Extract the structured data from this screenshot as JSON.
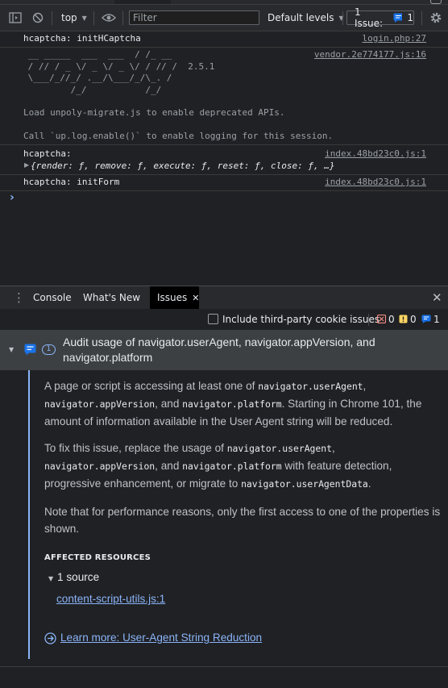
{
  "toolbar": {
    "context": "top",
    "filter_placeholder": "Filter",
    "levels": "Default levels",
    "issues_label": "1 Issue:",
    "issues_count": "1"
  },
  "console": {
    "messages": [
      {
        "text": "hcaptcha: initHCaptcha",
        "source": "login.php:27"
      },
      {
        "text": " __ _____  ___  ___  / /_ __\n / // / _ \\/ _ \\/ _ \\/ / // /  2.5.1\n \\___/_//_/ .__/\\___/_/\\_. /\n         /_/           /_/",
        "source": "vendor.2e774177.js:16",
        "note1": "Load unpoly-migrate.js to enable deprecated APIs.",
        "note2": "Call `up.log.enable()` to enable logging for this session."
      },
      {
        "text": "hcaptcha:",
        "source": "index.48bd23c0.js:1",
        "object": "{render: ƒ, remove: ƒ, execute: ƒ, reset: ƒ, close: ƒ, …}"
      },
      {
        "text": "hcaptcha: initForm",
        "source": "index.48bd23c0.js:1"
      }
    ],
    "prompt": "›"
  },
  "drawer": {
    "tabs": [
      "Console",
      "What's New",
      "Issues"
    ]
  },
  "issues": {
    "third_party_label": "Include third-party cookie issues",
    "errors": "0",
    "warnings": "0",
    "infos": "1",
    "issue": {
      "count": "1",
      "title": "Audit usage of navigator.userAgent, navigator.appVersion, and navigator.platform",
      "p1a": "A page or script is accessing at least one of ",
      "p1_code1": "navigator.userAgent",
      "p1b": ",",
      "p1_code2": "navigator.appVersion",
      "p1c": ", and ",
      "p1_code3": "navigator.platform",
      "p1d": ". Starting in Chrome 101, the amount of information available in the User Agent string will be reduced.",
      "p2a": "To fix this issue, replace the usage of ",
      "p2_code1": "navigator.userAgent",
      "p2b": ",",
      "p2_code2": "navigator.appVersion",
      "p2c": ", and ",
      "p2_code3": "navigator.platform",
      "p2d": " with feature detection, progressive enhancement, or migrate to ",
      "p2_code4": "navigator.userAgentData",
      "p2e": ".",
      "p3": "Note that for performance reasons, only the first access to one of the properties is shown.",
      "affected_heading": "AFFECTED RESOURCES",
      "source_count": "1 source",
      "resource": "content-script-utils.js:1",
      "learn_more": "Learn more: User-Agent String Reduction"
    }
  },
  "colors": {
    "accent": "#8ab4f8",
    "error": "#f28b82",
    "warning": "#fdd663",
    "panel": "#202124"
  }
}
